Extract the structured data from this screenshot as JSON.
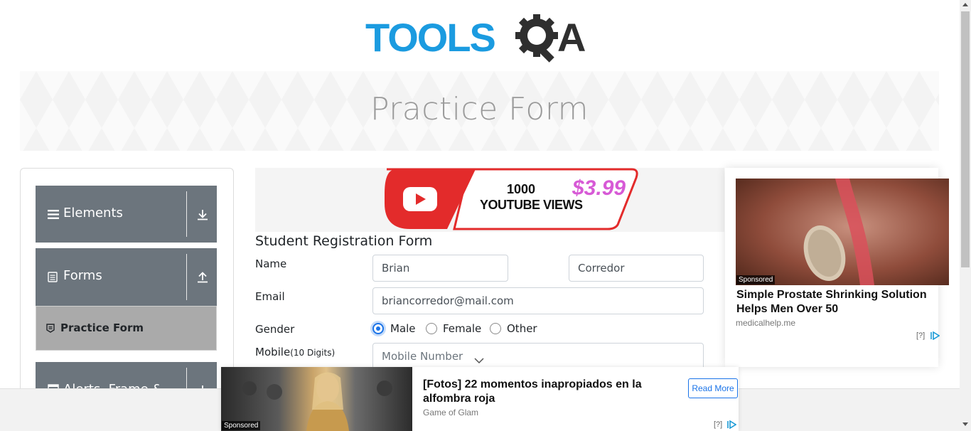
{
  "header": {
    "logo_text": "TOOLS",
    "logo_suffix": "A",
    "logo_alt": "TOOLSQA"
  },
  "banner": {
    "title": "Practice Form"
  },
  "sidebar": {
    "groups": [
      {
        "label": "Elements",
        "icon": "hamburger-icon",
        "arrow": "download-arrow-icon"
      },
      {
        "label": "Forms",
        "icon": "document-icon",
        "arrow": "upload-arrow-icon"
      },
      {
        "label": "Alerts, Frame &",
        "icon": "window-icon",
        "arrow": "download-arrow-icon"
      }
    ],
    "active_item": {
      "label": "Practice Form",
      "icon": "form-icon"
    }
  },
  "top_ad": {
    "line1": "1000",
    "line2": "YOUTUBE VIEWS",
    "price": "$3.99"
  },
  "form": {
    "title": "Student Registration Form",
    "name_label": "Name",
    "first_name": "Brian",
    "last_name": "Corredor",
    "email_label": "Email",
    "email": "briancorredor@mail.com",
    "gender_label": "Gender",
    "gender_options": [
      "Male",
      "Female",
      "Other"
    ],
    "gender_selected": "Male",
    "mobile_label": "Mobile",
    "mobile_hint": "(10 Digits)",
    "mobile_placeholder": "Mobile Number"
  },
  "right_ad": {
    "sponsored": "Sponsored",
    "headline": "Simple Prostate Shrinking Solution Helps Men Over 50",
    "source": "medicalhelp.me",
    "info": "[?]"
  },
  "bottom_ad": {
    "sponsored": "Sponsored",
    "headline": "[Fotos] 22 momentos inapropiados en la alfombra roja",
    "source": "Game of Glam",
    "cta": "Read More",
    "info": "[?]"
  },
  "colors": {
    "brand_blue": "#1b9be0",
    "brand_dark": "#2f2f2f",
    "sidebar_group": "#6c757d",
    "sidebar_active": "#aaaaaa",
    "radio_selected": "#1a73e8"
  }
}
